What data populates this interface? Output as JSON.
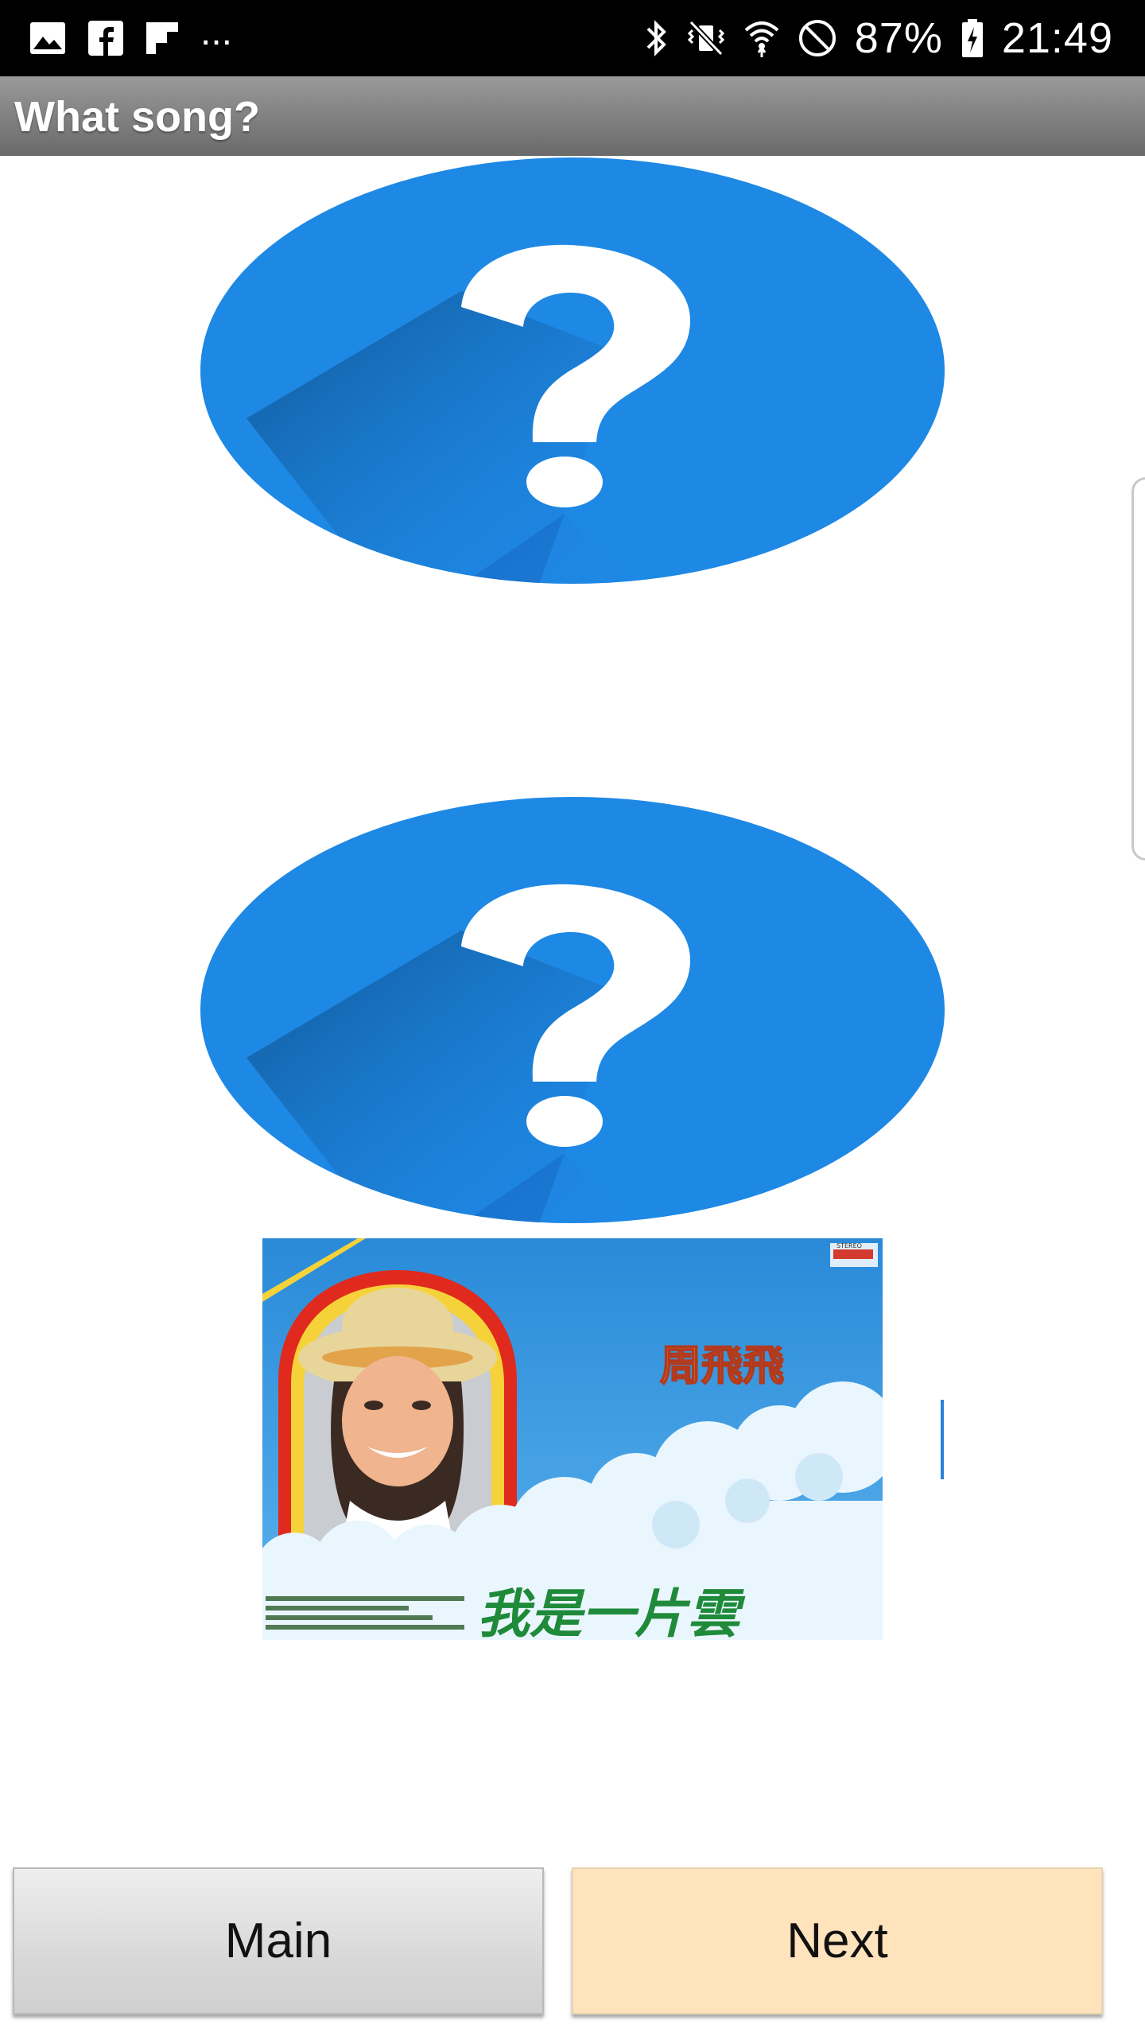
{
  "status_bar": {
    "left_icons": [
      "image-icon",
      "facebook-icon",
      "flipboard-icon"
    ],
    "overflow_dots": "...",
    "right_icons": [
      "bluetooth-icon",
      "vibrate-mute-icon",
      "wifi-icon",
      "do-not-disturb-icon"
    ],
    "battery_percent": "87%",
    "battery_icon": "battery-charging-icon",
    "time": "21:49"
  },
  "action_bar": {
    "title": "What song?"
  },
  "tiles": [
    {
      "icon": "question-mark-icon",
      "color": "#1e88e5"
    },
    {
      "icon": "question-mark-icon",
      "color": "#1e88e5"
    }
  ],
  "album": {
    "artist_text": "周飛飛",
    "title_text": "我是一片雲",
    "stereo_label": "STEREO",
    "colors": {
      "sky": "#2a8ad8",
      "frame_red": "#e02a1d",
      "frame_yellow": "#f6d23a",
      "title_green": "#1f8a3a"
    }
  },
  "buttons": {
    "main_label": "Main",
    "next_label": "Next"
  },
  "colors": {
    "status_bar": "#000000",
    "action_bar": "#8a8a8a",
    "next_button_bg": "#ffe3bc",
    "main_button_bg": "#dddddd"
  }
}
